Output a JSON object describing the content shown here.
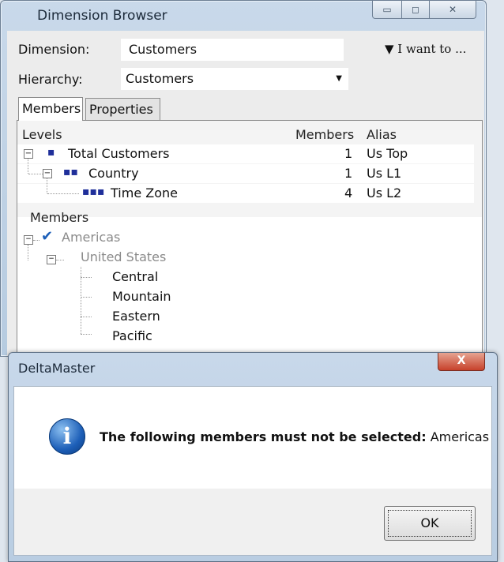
{
  "window": {
    "title": "Dimension Browser",
    "min_glyph": "▭",
    "max_glyph": "◻",
    "close_glyph": "✕"
  },
  "form": {
    "dimension_label": "Dimension:",
    "dimension_value": "Customers",
    "i_want_to": "▼ I want to ...",
    "hierarchy_label": "Hierarchy:",
    "hierarchy_value": "Customers",
    "hierarchy_arrow": "▼"
  },
  "tabs": [
    {
      "label": "Members"
    },
    {
      "label": "Properties"
    }
  ],
  "levels": {
    "headers": {
      "levels": "Levels",
      "members": "Members",
      "alias": "Alias"
    },
    "rows": [
      {
        "name": "Total Customers",
        "count": "1",
        "alias": "Us Top",
        "dots": "▪",
        "toggle": "−"
      },
      {
        "name": "Country",
        "count": "1",
        "alias": "Us L1",
        "dots": "▪▪",
        "toggle": "−"
      },
      {
        "name": "Time Zone",
        "count": "4",
        "alias": "Us L2",
        "dots": "▪▪▪",
        "toggle": ""
      }
    ]
  },
  "members": {
    "header": "Members",
    "items": [
      {
        "label": "Americas",
        "check": "✔"
      },
      {
        "label": "United States"
      },
      {
        "label": "Central"
      },
      {
        "label": "Mountain"
      },
      {
        "label": "Eastern"
      },
      {
        "label": "Pacific"
      }
    ]
  },
  "dialog": {
    "title": "DeltaMaster",
    "close_glyph": "X",
    "info_glyph": "i",
    "message_bold": "The following members must not be selected:",
    "message_value": "Americas",
    "ok_label": "OK"
  },
  "colors": {
    "accent_blue": "#1d5fb8",
    "close_red": "#c7412b"
  }
}
